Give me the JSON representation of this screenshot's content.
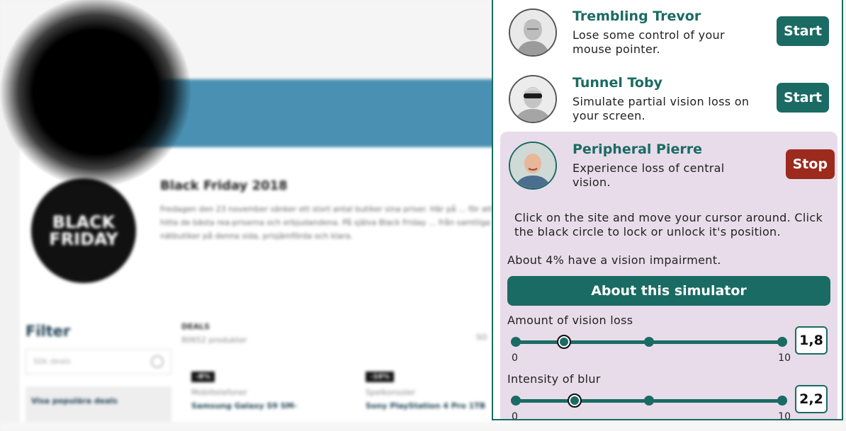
{
  "site": {
    "logo_text": "BLACK\nFRIDAY",
    "title": "Black Friday 2018",
    "intro": "Fredagen den 23 november sänker ett stort antal butiker sina priser. Här på ... för att hitta de bästa rea-priserna och erbjudandena. På själva Black Friday ... från samtliga nätbutiker på denna sida, prisjämförda och klara.",
    "filter_title": "Filter",
    "search_placeholder": "Sök deals",
    "popular_label": "Visa populära deals",
    "deals_label": "DEALS",
    "deals_count": "80652 produkter",
    "sort_label": "SO",
    "products": [
      {
        "badge": "-8%",
        "category": "Mobiltelefoner",
        "name": "Samsung Galaxy S9 SM-"
      },
      {
        "badge": "-10%",
        "category": "Spelkonsoler",
        "name": "Sony PlayStation 4 Pro 1TB"
      }
    ]
  },
  "panel": {
    "simulators": [
      {
        "name": "Trembling Trevor",
        "description": "Lose some control of your mouse pointer.",
        "button": "Start",
        "state": "inactive"
      },
      {
        "name": "Tunnel Toby",
        "description": "Simulate partial vision loss on your screen.",
        "button": "Start",
        "state": "inactive"
      },
      {
        "name": "Peripheral Pierre",
        "description": "Experience loss of central vision.",
        "button": "Stop",
        "state": "active"
      }
    ],
    "instructions": "Click on the site and move your cursor around. Click the black circle to lock or unlock it's position.",
    "stat": "About 4% have a vision impairment.",
    "about_button": "About this simulator",
    "sliders": [
      {
        "label": "Amount of vision loss",
        "min": "0",
        "max": "10",
        "value": 1.8,
        "value_text": "1,8"
      },
      {
        "label": "Intensity of blur",
        "min": "0",
        "max": "10",
        "value": 2.2,
        "value_text": "2,2"
      }
    ],
    "colors": {
      "primary": "#1a6b63",
      "stop": "#9c2a1d",
      "active_bg": "#e8dcea"
    }
  }
}
